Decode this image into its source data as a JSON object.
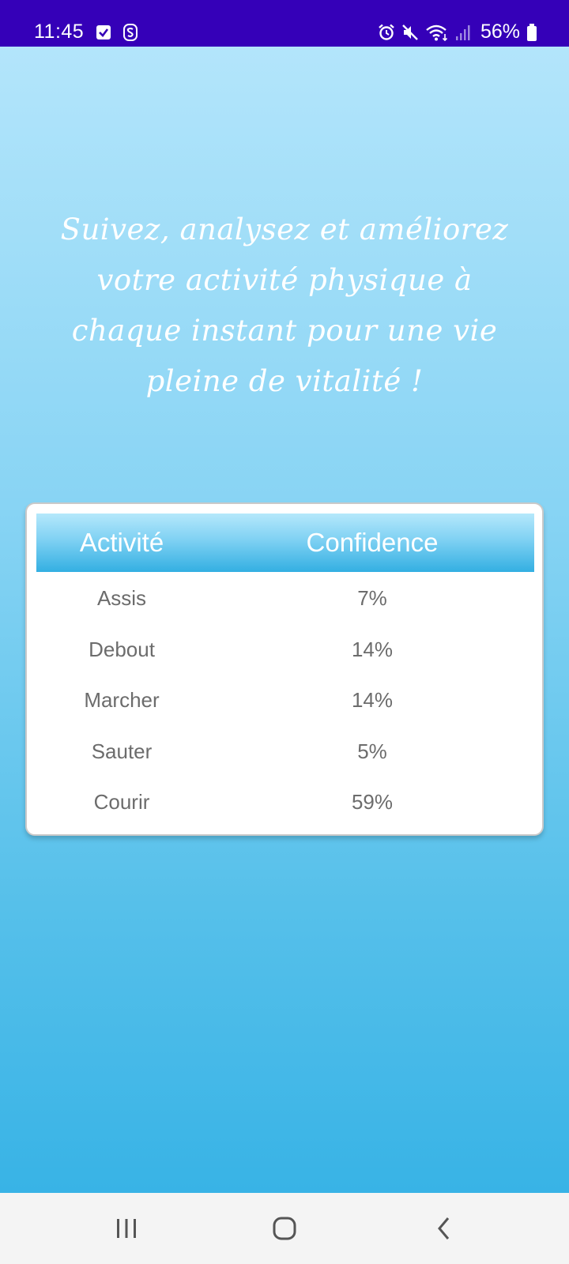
{
  "status_bar": {
    "time": "11:45",
    "battery_percent": "56%",
    "icons": [
      "checkbox-notification-icon",
      "s-app-icon",
      "alarm-icon",
      "mute-icon",
      "wifi-icon",
      "signal-icon",
      "battery-icon"
    ]
  },
  "tagline": "Suivez, analysez et améliorez votre activité physique à chaque instant pour une vie pleine de vitalité !",
  "table": {
    "headers": {
      "activity": "Activité",
      "confidence": "Confidence"
    },
    "rows": [
      {
        "activity": "Assis",
        "confidence": "7%"
      },
      {
        "activity": "Debout",
        "confidence": "14%"
      },
      {
        "activity": "Marcher",
        "confidence": "14%"
      },
      {
        "activity": "Sauter",
        "confidence": "5%"
      },
      {
        "activity": "Courir",
        "confidence": "59%"
      }
    ]
  },
  "colors": {
    "status_bar": "#3500b8",
    "header_gradient_bottom": "#33afe2",
    "background_top": "#b3e5fb",
    "background_bottom": "#38b3e6",
    "row_text": "#6c6c6c"
  }
}
